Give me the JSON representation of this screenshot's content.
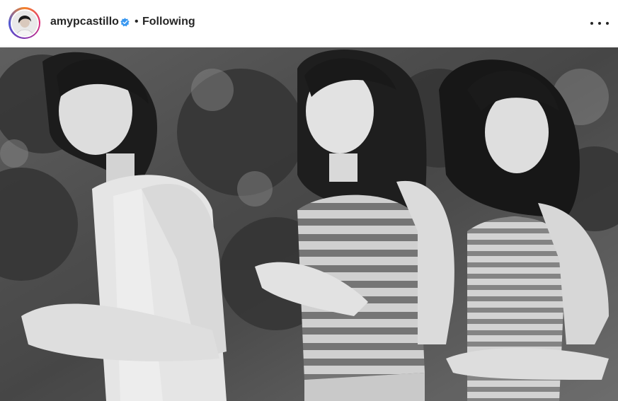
{
  "post_header": {
    "username": "amypcastillo",
    "verified_icon": "verified-badge-icon",
    "separator": "•",
    "follow_status": "Following",
    "more_icon": "more-options-icon"
  },
  "photo": {
    "style": "black-and-white vintage photograph",
    "subjects_count": 3
  },
  "colors": {
    "verified": "#3897f0",
    "text": "#262626",
    "ring_start": "#f58529",
    "ring_end": "#515bd4"
  }
}
